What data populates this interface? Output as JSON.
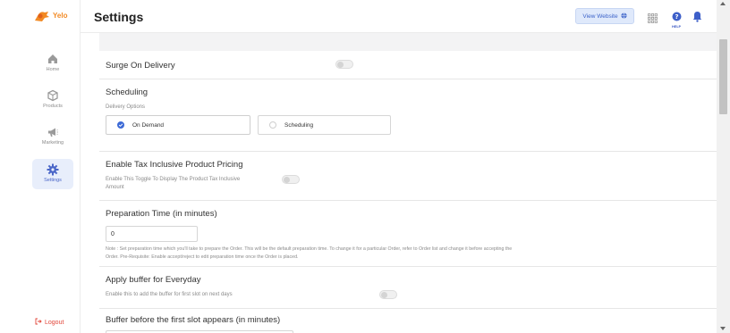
{
  "app": {
    "logo_text": "Yelo",
    "brand_color": "#f28a24",
    "accent_color": "#3d6ad6"
  },
  "sidebar": {
    "items": [
      {
        "label": "Home",
        "icon": "home-icon"
      },
      {
        "label": "Products",
        "icon": "box-icon"
      },
      {
        "label": "Marketing",
        "icon": "megaphone-icon"
      },
      {
        "label": "Settings",
        "icon": "gear-icon"
      }
    ],
    "logout_label": "Logout"
  },
  "header": {
    "title": "Settings",
    "view_website_label": "View Website",
    "help_label": "HELP"
  },
  "settings": {
    "surge": {
      "title": "Surge On Delivery"
    },
    "scheduling": {
      "title": "Scheduling",
      "delivery_options_label": "Delivery Options",
      "options": [
        "On Demand",
        "Scheduling"
      ],
      "selected": "On Demand"
    },
    "tax": {
      "title": "Enable Tax Inclusive Product Pricing",
      "description_line1": "Enable This Toggle To Display The Product Tax Inclusive",
      "description_line2": "Amount"
    },
    "preparation": {
      "title": "Preparation Time (in minutes)",
      "value": "0",
      "note_line1": "Note : Set preparation time which you'll take to prepare the Order. This will be the default preparation time. To change it for a particular Order, refer to Order list and change it before accepting the",
      "note_line2": "Order. Pre-Requisite: Enable accept/reject to edit preparation time once the Order is placed."
    },
    "buffer_everyday": {
      "title": "Apply buffer for Everyday",
      "description": "Enable this to add the buffer for first slot on next days"
    },
    "buffer_first_slot": {
      "title": "Buffer before the first slot appears (in minutes)"
    }
  }
}
